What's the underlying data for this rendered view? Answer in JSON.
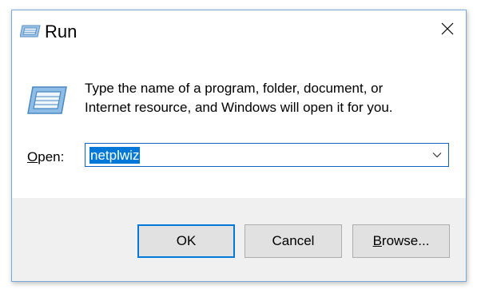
{
  "window": {
    "title": "Run",
    "icon": "run-icon",
    "close_icon": "close-icon"
  },
  "content": {
    "description_line1": "Type the name of a program, folder, document, or",
    "description_line2": "Internet resource, and Windows will open it for you.",
    "open_label_accel": "O",
    "open_label_rest": "pen:",
    "open_value": "netplwiz",
    "dropdown_icon": "chevron-down-icon"
  },
  "buttons": {
    "ok": "OK",
    "cancel": "Cancel",
    "browse_accel": "B",
    "browse_rest": "rowse..."
  },
  "colors": {
    "selection": "#0078d7",
    "focus_border": "#0078d7",
    "footer_bg": "#f0f0f0",
    "button_bg": "#e1e1e1"
  }
}
